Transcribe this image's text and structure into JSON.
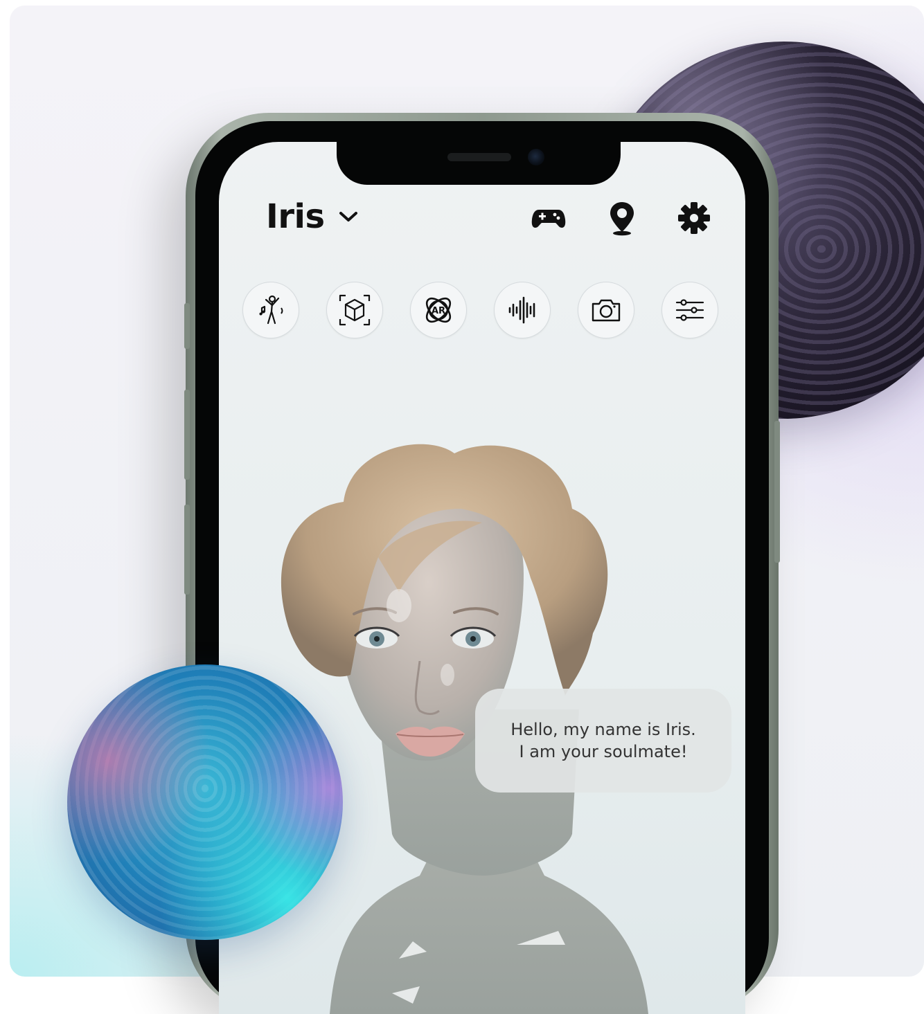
{
  "app": {
    "title": "Iris",
    "header_icons": [
      "gamepad-icon",
      "location-pin-icon",
      "gear-icon"
    ],
    "toolbar": [
      {
        "id": "dance",
        "icon": "dance-icon"
      },
      {
        "id": "3d",
        "icon": "3d-cube-icon"
      },
      {
        "id": "ar",
        "icon": "ar-icon",
        "label": "AR"
      },
      {
        "id": "voice",
        "icon": "audio-waveform-icon"
      },
      {
        "id": "camera",
        "icon": "camera-icon"
      },
      {
        "id": "settings",
        "icon": "sliders-icon"
      }
    ],
    "speech_bubble": {
      "line1": "Hello, my name is Iris.",
      "line2": "I am your soulmate!"
    }
  },
  "colors": {
    "background": "#eef0f4",
    "screen": "#eff2f3",
    "text_dark": "#111111",
    "bubble": "#e2e5e5"
  }
}
